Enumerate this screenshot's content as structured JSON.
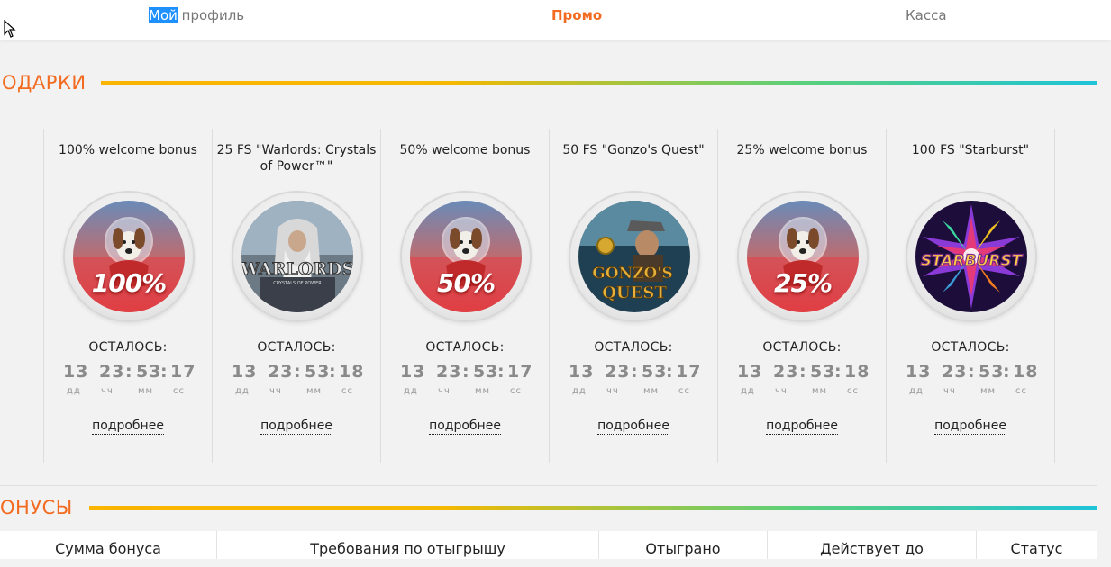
{
  "nav": {
    "profile_selected": "Мой",
    "profile_rest": " профиль",
    "promo": "Промо",
    "cashier": "Касса"
  },
  "gifts": {
    "title": "ОДАРКИ",
    "cards": [
      {
        "title": "100% welcome bonus",
        "badge": "100%",
        "badge_type": "dog",
        "left_label": "ОСТАЛОСЬ:",
        "days": "13",
        "hours": "23",
        "minutes": "53",
        "seconds": "17",
        "more": "подробнее"
      },
      {
        "title": "25 FS \"Warlords: Crystals of Power™\"",
        "badge": "WARLORDS",
        "badge_sub": "CRYSTALS OF POWER",
        "badge_type": "warlords",
        "left_label": "ОСТАЛОСЬ:",
        "days": "13",
        "hours": "23",
        "minutes": "53",
        "seconds": "18",
        "more": "подробнее"
      },
      {
        "title": "50% welcome bonus",
        "badge": "50%",
        "badge_type": "dog",
        "left_label": "ОСТАЛОСЬ:",
        "days": "13",
        "hours": "23",
        "minutes": "53",
        "seconds": "17",
        "more": "подробнее"
      },
      {
        "title": "50 FS \"Gonzo's Quest\"",
        "badge": "Gonzo's Quest",
        "badge_type": "gonzo",
        "left_label": "ОСТАЛОСЬ:",
        "days": "13",
        "hours": "23",
        "minutes": "53",
        "seconds": "17",
        "more": "подробнее"
      },
      {
        "title": "25% welcome bonus",
        "badge": "25%",
        "badge_type": "dog",
        "left_label": "ОСТАЛОСЬ:",
        "days": "13",
        "hours": "23",
        "minutes": "53",
        "seconds": "18",
        "more": "подробнее"
      },
      {
        "title": "100 FS \"Starburst\"",
        "badge": "STARBURST",
        "badge_type": "starburst",
        "left_label": "ОСТАЛОСЬ:",
        "days": "13",
        "hours": "23",
        "minutes": "53",
        "seconds": "18",
        "more": "подробнее"
      }
    ],
    "units": {
      "days": "дд",
      "hours": "чч",
      "minutes": "мм",
      "seconds": "сс"
    }
  },
  "bonuses": {
    "title": "ОНУСЫ",
    "columns": [
      "Сумма бонуса",
      "Требования по отыгрышу",
      "Отыграно",
      "Действует до",
      "Статус"
    ]
  },
  "colors": {
    "accent": "#f26b21",
    "selection": "#1e90ff"
  }
}
